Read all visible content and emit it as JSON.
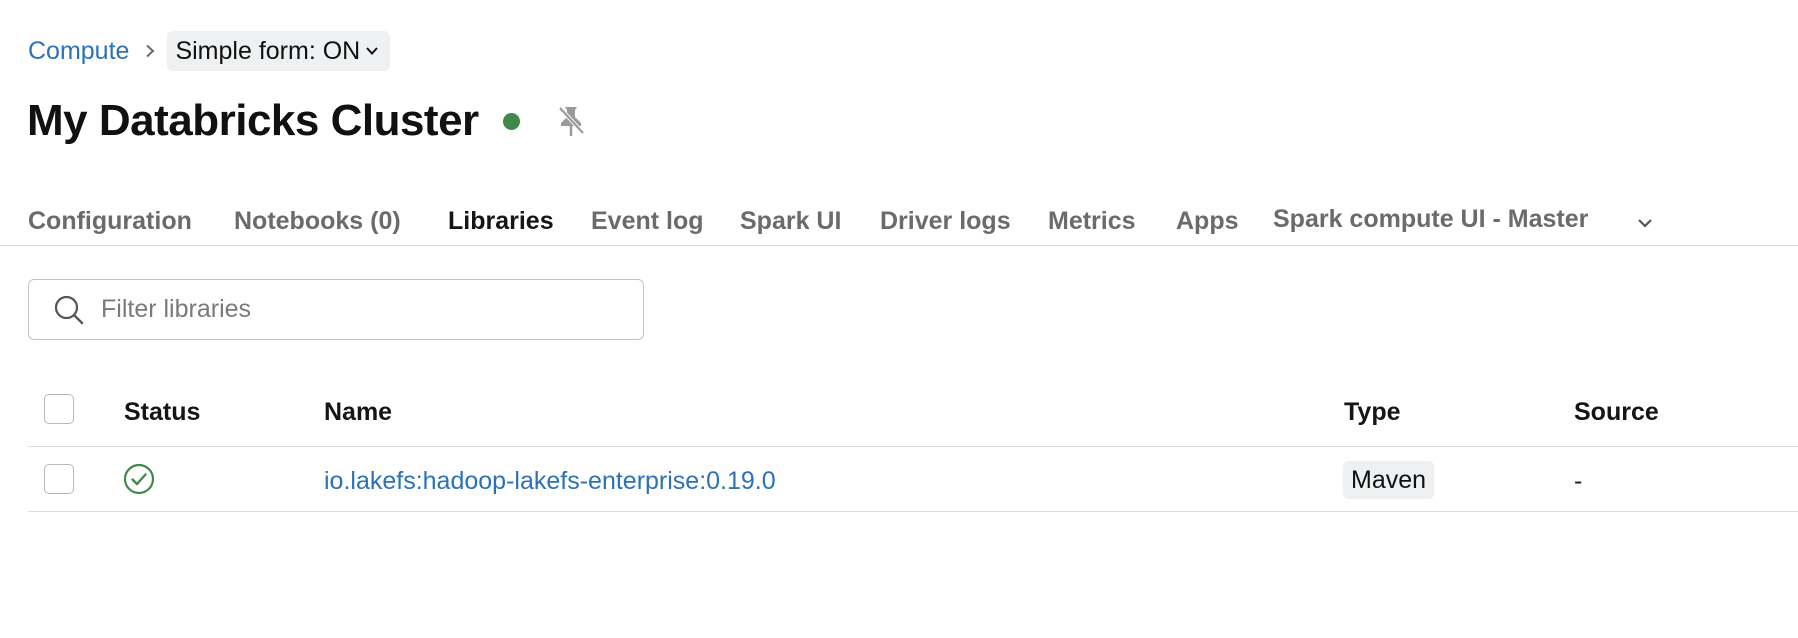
{
  "breadcrumb": {
    "parent_label": "Compute",
    "simple_form_label": "Simple form: ON"
  },
  "header": {
    "title": "My Databricks Cluster",
    "status_color": "#3f8a4a",
    "status_icon": "status-dot",
    "pin_icon": "pin-off-icon"
  },
  "tabs": [
    {
      "label": "Configuration",
      "active": false
    },
    {
      "label": "Notebooks (0)",
      "active": false
    },
    {
      "label": "Libraries",
      "active": true
    },
    {
      "label": "Event log",
      "active": false
    },
    {
      "label": "Spark UI",
      "active": false
    },
    {
      "label": "Driver logs",
      "active": false
    },
    {
      "label": "Metrics",
      "active": false
    },
    {
      "label": "Apps",
      "active": false
    },
    {
      "label": "Spark compute UI - Master",
      "active": false
    }
  ],
  "filter": {
    "placeholder": "Filter libraries",
    "value": ""
  },
  "table": {
    "columns": {
      "status": "Status",
      "name": "Name",
      "type": "Type",
      "source": "Source"
    },
    "rows": [
      {
        "status_icon": "check-circle-icon",
        "status_color": "#3f8a4a",
        "name": "io.lakefs:hadoop-lakefs-enterprise:0.19.0",
        "type": "Maven",
        "source": "-"
      }
    ]
  },
  "colors": {
    "link": "#2b72b8",
    "success": "#3f8a4a",
    "tab_inactive": "#6b6b6b",
    "tab_active": "#151515"
  }
}
